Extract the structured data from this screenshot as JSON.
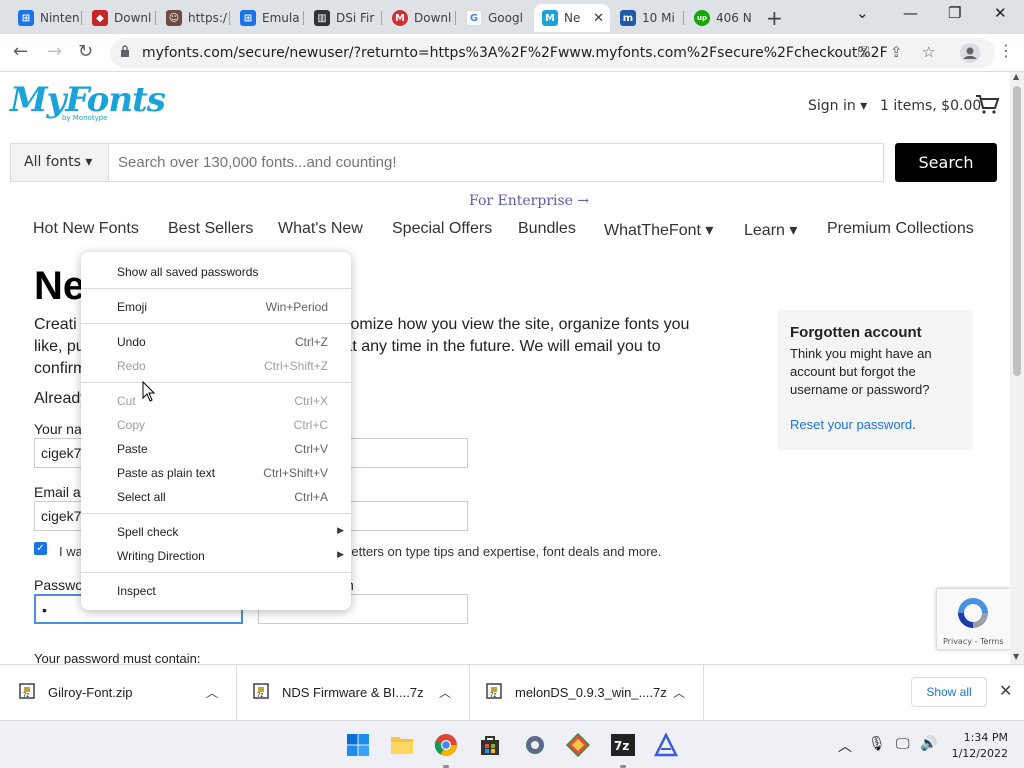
{
  "browser": {
    "tabs": [
      {
        "label": "Ninten",
        "color": "#1a73e8",
        "glyph": "⊞"
      },
      {
        "label": "Downl",
        "color": "#c62828",
        "glyph": "◆"
      },
      {
        "label": "https:/",
        "color": "#6d4c41",
        "glyph": "☺"
      },
      {
        "label": "Emula",
        "color": "#1a73e8",
        "glyph": "⊞"
      },
      {
        "label": "DSi Fir",
        "color": "#333333",
        "glyph": "▥"
      },
      {
        "label": "Downl",
        "color": "#d32f2f",
        "glyph": "M"
      },
      {
        "label": "Googl",
        "color": "#4285f4",
        "glyph": "G"
      },
      {
        "label": "Ne",
        "color": "#1aa3d9",
        "glyph": "M"
      },
      {
        "label": "10 Mi",
        "color": "#1e5aa8",
        "glyph": "m"
      },
      {
        "label": "406 N",
        "color": "#14a800",
        "glyph": "up"
      }
    ],
    "active_tab_index": 7,
    "url": "myfonts.com/secure/newuser/?returnto=https%3A%2F%2Fwww.myfonts.com%2Fsecure%2Fcheckout%2F"
  },
  "site": {
    "logo": "MyFonts",
    "logo_sub": "by Monotype",
    "signin": "Sign in ▾",
    "cart": "1 items, $0.00",
    "search_category": "All fonts ▾",
    "search_placeholder": "Search over 130,000 fonts...and counting!",
    "search_button": "Search",
    "enterprise": "For Enterprise →",
    "nav": [
      "Hot New Fonts",
      "Best Sellers",
      "What's New",
      "Special Offers",
      "Bundles",
      "WhatTheFont ▾",
      "Learn ▾",
      "Premium Collections"
    ]
  },
  "form": {
    "heading": "Ne",
    "intro_lines": [
      "Creati                                                    o customize how you view the site, organize fonts you",
      "like, pu                                               orders at any time in the future. We will email you to",
      "confirm"
    ],
    "already": "Already",
    "name_label": "Your na",
    "name_value": "cigek7",
    "email_label": "Email a",
    "email_value": "cigek7",
    "newsletter_prefix": "I wa",
    "newsletter_text": "sletters on type tips and expertise, font deals and more.",
    "password_label": "Passwo",
    "password_confirm_label": "n",
    "password_value": "•",
    "password_requirements": "Your password must contain:"
  },
  "forgotten": {
    "title": "Forgotten account",
    "text": "Think you might have an account but forgot the username or password?",
    "link": "Reset your password",
    "link_suffix": "."
  },
  "recaptcha": {
    "terms": "Privacy - Terms"
  },
  "context_menu": {
    "items": [
      {
        "label": "Show all saved passwords",
        "shortcut": "",
        "disabled": false
      },
      {
        "label": "Emoji",
        "shortcut": "Win+Period",
        "disabled": false
      },
      {
        "label": "Undo",
        "shortcut": "Ctrl+Z",
        "disabled": false
      },
      {
        "label": "Redo",
        "shortcut": "Ctrl+Shift+Z",
        "disabled": true
      },
      {
        "label": "Cut",
        "shortcut": "Ctrl+X",
        "disabled": true
      },
      {
        "label": "Copy",
        "shortcut": "Ctrl+C",
        "disabled": true
      },
      {
        "label": "Paste",
        "shortcut": "Ctrl+V",
        "disabled": false
      },
      {
        "label": "Paste as plain text",
        "shortcut": "Ctrl+Shift+V",
        "disabled": false
      },
      {
        "label": "Select all",
        "shortcut": "Ctrl+A",
        "disabled": false
      },
      {
        "label": "Spell check",
        "shortcut": "",
        "disabled": false,
        "submenu": true
      },
      {
        "label": "Writing Direction",
        "shortcut": "",
        "disabled": false,
        "submenu": true
      },
      {
        "label": "Inspect",
        "shortcut": "",
        "disabled": false
      }
    ]
  },
  "downloads": {
    "items": [
      {
        "name": "Gilroy-Font.zip"
      },
      {
        "name": "NDS Firmware & BI....7z"
      },
      {
        "name": "melonDS_0.9.3_win_....7z"
      }
    ],
    "show_all": "Show all"
  },
  "taskbar": {
    "time": "1:34 PM",
    "date": "1/12/2022"
  },
  "colors": {
    "brand": "#1aa3d9",
    "link": "#1a73e8",
    "enterprise": "#5b5bb0"
  }
}
